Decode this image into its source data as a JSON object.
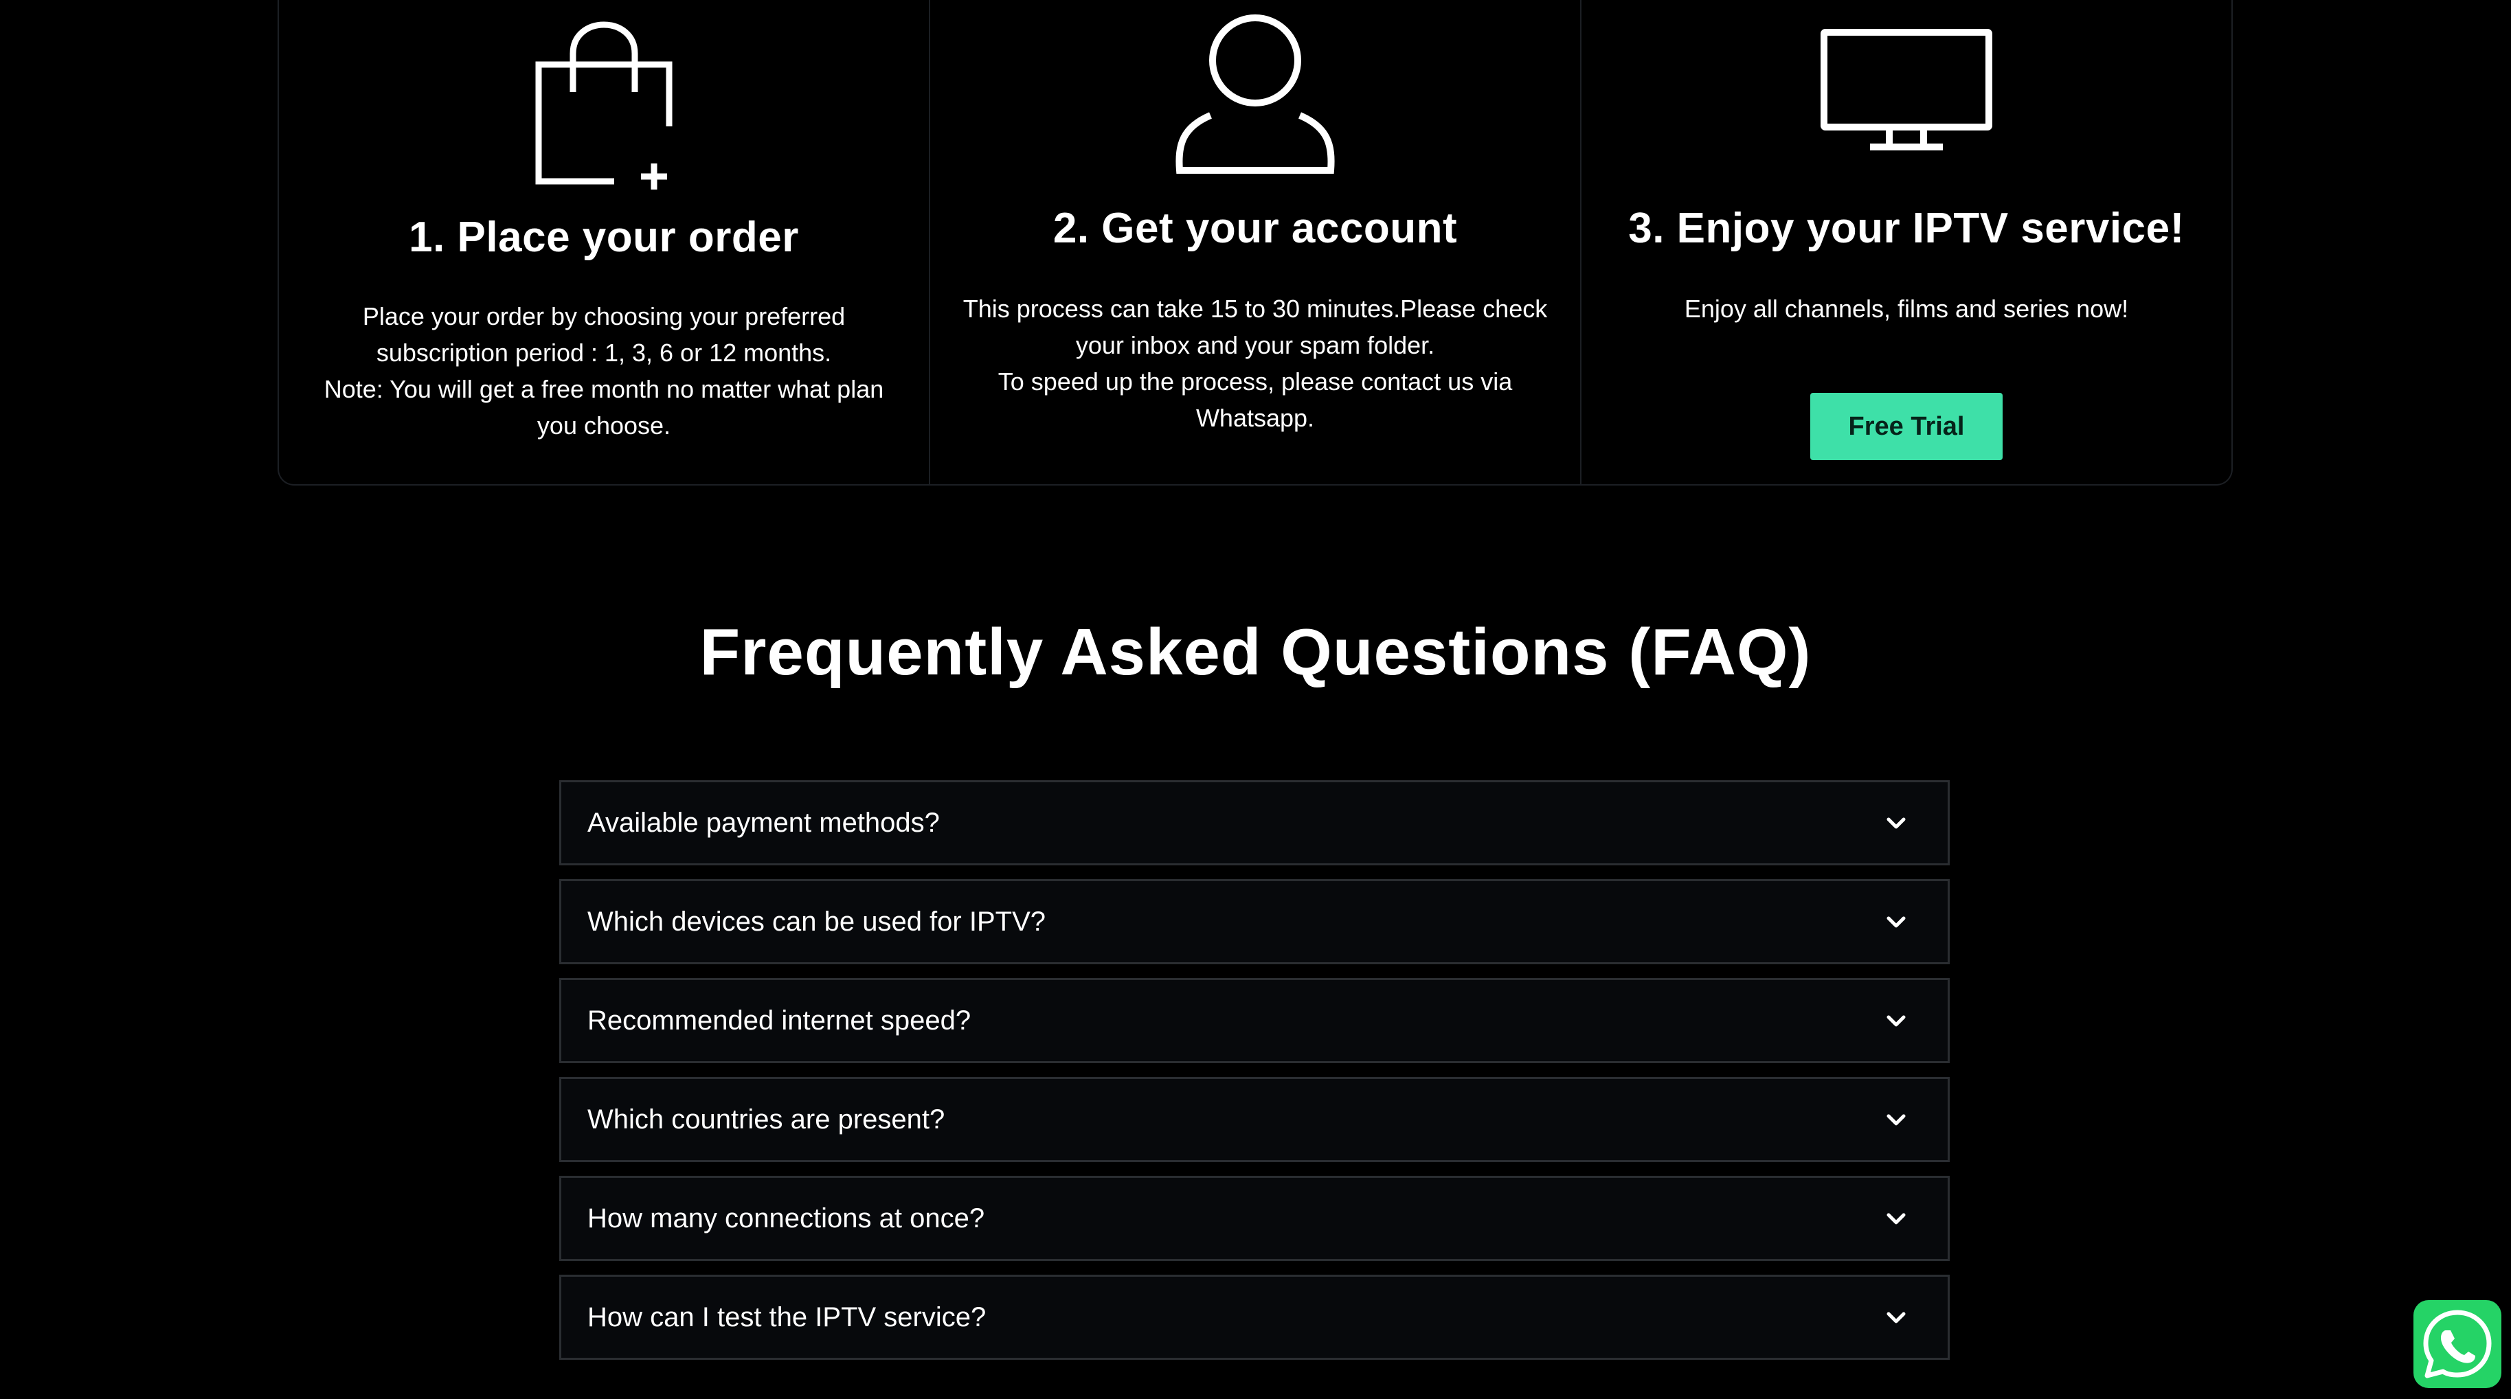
{
  "steps": [
    {
      "icon": "shopping-bag-plus-icon",
      "title": "1. Place your order",
      "lines": [
        "Place your order by choosing your preferred subscription period : 1, 3, 6 or 12 months.",
        "Note: You will get a free month no matter what plan you choose."
      ]
    },
    {
      "icon": "user-icon",
      "title": "2. Get your account",
      "lines": [
        "This process can take 15 to 30 minutes.Please check your inbox and your spam folder.",
        "To speed up the process, please contact us via Whatsapp."
      ]
    },
    {
      "icon": "tv-monitor-icon",
      "title": "3. Enjoy your IPTV service!",
      "lines": [
        "Enjoy all channels, films and series now!"
      ],
      "button_label": "Free Trial"
    }
  ],
  "faq": {
    "title": "Frequently Asked Questions (FAQ)",
    "items": [
      "Available payment methods?",
      "Which devices can be used for IPTV?",
      "Recommended internet speed?",
      "Which countries are present?",
      "How many connections at once?",
      "How can I test the IPTV service?"
    ]
  },
  "whatsapp": {
    "icon": "whatsapp-icon"
  },
  "colors": {
    "background": "#000000",
    "accent": "#3ee0a8",
    "faq_item_bg": "#07090c",
    "border": "#2a2d31",
    "whatsapp_green": "#25d366"
  }
}
